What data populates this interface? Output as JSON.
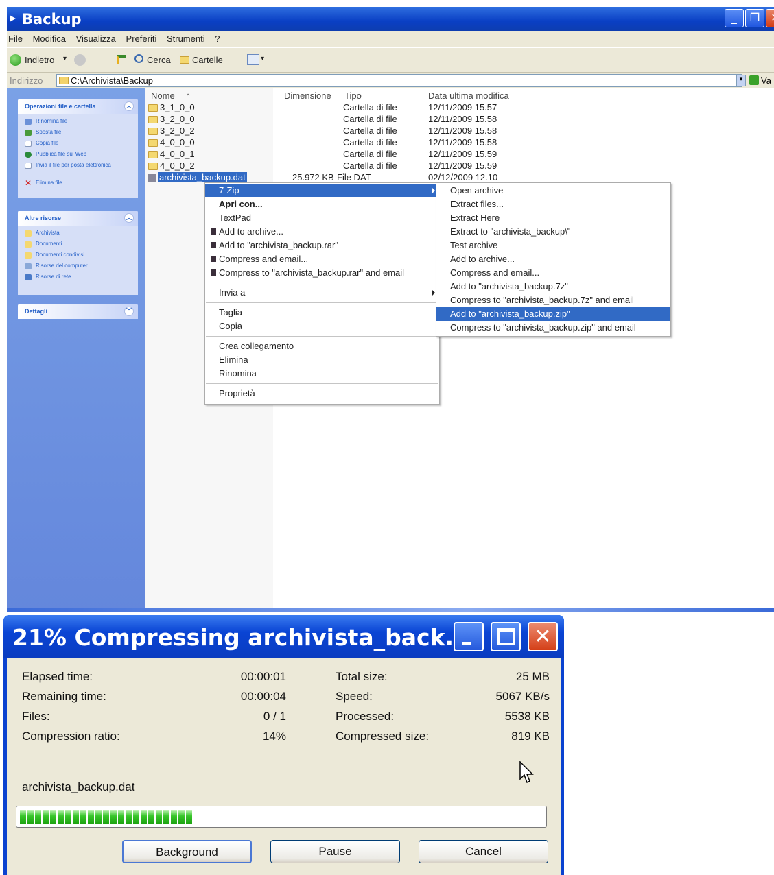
{
  "explorer": {
    "title": "Backup",
    "menu": [
      "File",
      "Modifica",
      "Visualizza",
      "Preferiti",
      "Strumenti",
      "?"
    ],
    "toolbar": {
      "back": "Indietro",
      "search": "Cerca",
      "folders": "Cartelle"
    },
    "address": {
      "label": "Indirizzo",
      "value": "C:\\Archivista\\Backup",
      "go": "Va"
    },
    "tasks": {
      "file_folder_tasks": {
        "title": "Operazioni file e cartella",
        "items": [
          "Rinomina file",
          "Sposta file",
          "Copia file",
          "Pubblica file sul Web",
          "Invia il file per posta elettronica",
          "Elimina file"
        ]
      },
      "other_places": {
        "title": "Altre risorse",
        "items": [
          "Archivista",
          "Documenti",
          "Documenti condivisi",
          "Risorse del computer",
          "Risorse di rete"
        ]
      },
      "details": {
        "title": "Dettagli"
      }
    },
    "columns": {
      "name": "Nome",
      "size": "Dimensione",
      "type": "Tipo",
      "modified": "Data ultima modifica"
    },
    "files": [
      {
        "name": "3_1_0_0",
        "size": "",
        "type": "Cartella di file",
        "modified": "12/11/2009 15.57"
      },
      {
        "name": "3_2_0_0",
        "size": "",
        "type": "Cartella di file",
        "modified": "12/11/2009 15.58"
      },
      {
        "name": "3_2_0_2",
        "size": "",
        "type": "Cartella di file",
        "modified": "12/11/2009 15.58"
      },
      {
        "name": "4_0_0_0",
        "size": "",
        "type": "Cartella di file",
        "modified": "12/11/2009 15.58"
      },
      {
        "name": "4_0_0_1",
        "size": "",
        "type": "Cartella di file",
        "modified": "12/11/2009 15.59"
      },
      {
        "name": "4_0_0_2",
        "size": "",
        "type": "Cartella di file",
        "modified": "12/11/2009 15.59"
      },
      {
        "name": "archivista_backup.dat",
        "size": "25.972 KB",
        "type": "File DAT",
        "modified": "02/12/2009 12.10"
      }
    ]
  },
  "context_menu": {
    "items": [
      "7-Zip",
      "Apri con...",
      "TextPad",
      "Add to archive...",
      "Add to \"archivista_backup.rar\"",
      "Compress and email...",
      "Compress to \"archivista_backup.rar\" and email",
      "Invia a",
      "Taglia",
      "Copia",
      "Crea collegamento",
      "Elimina",
      "Rinomina",
      "Proprietà"
    ]
  },
  "submenu_7zip": {
    "items": [
      "Open archive",
      "Extract files...",
      "Extract Here",
      "Extract to \"archivista_backup\\\"",
      "Test archive",
      "Add to archive...",
      "Compress and email...",
      "Add to \"archivista_backup.7z\"",
      "Compress to \"archivista_backup.7z\" and email",
      "Add to \"archivista_backup.zip\"",
      "Compress to \"archivista_backup.zip\" and email"
    ],
    "highlighted_index": 9
  },
  "progress_dialog": {
    "title": "21% Compressing archivista_back...",
    "left_stats": [
      {
        "label": "Elapsed time:",
        "value": "00:00:01"
      },
      {
        "label": "Remaining time:",
        "value": "00:00:04"
      },
      {
        "label": "Files:",
        "value": "0 / 1"
      },
      {
        "label": "Compression ratio:",
        "value": "14%"
      }
    ],
    "right_stats": [
      {
        "label": "Total size:",
        "value": "25 MB"
      },
      {
        "label": "Speed:",
        "value": "5067 KB/s"
      },
      {
        "label": "Processed:",
        "value": "5538 KB"
      },
      {
        "label": "Compressed size:",
        "value": "819 KB"
      }
    ],
    "current_file": "archivista_backup.dat",
    "progress_fraction": 0.21,
    "buttons": {
      "background": "Background",
      "pause": "Pause",
      "cancel": "Cancel"
    }
  },
  "colors": {
    "titlebar": "#0a3fc4",
    "highlight": "#316ac5",
    "progress": "#37c62a",
    "close": "#e3502f"
  }
}
